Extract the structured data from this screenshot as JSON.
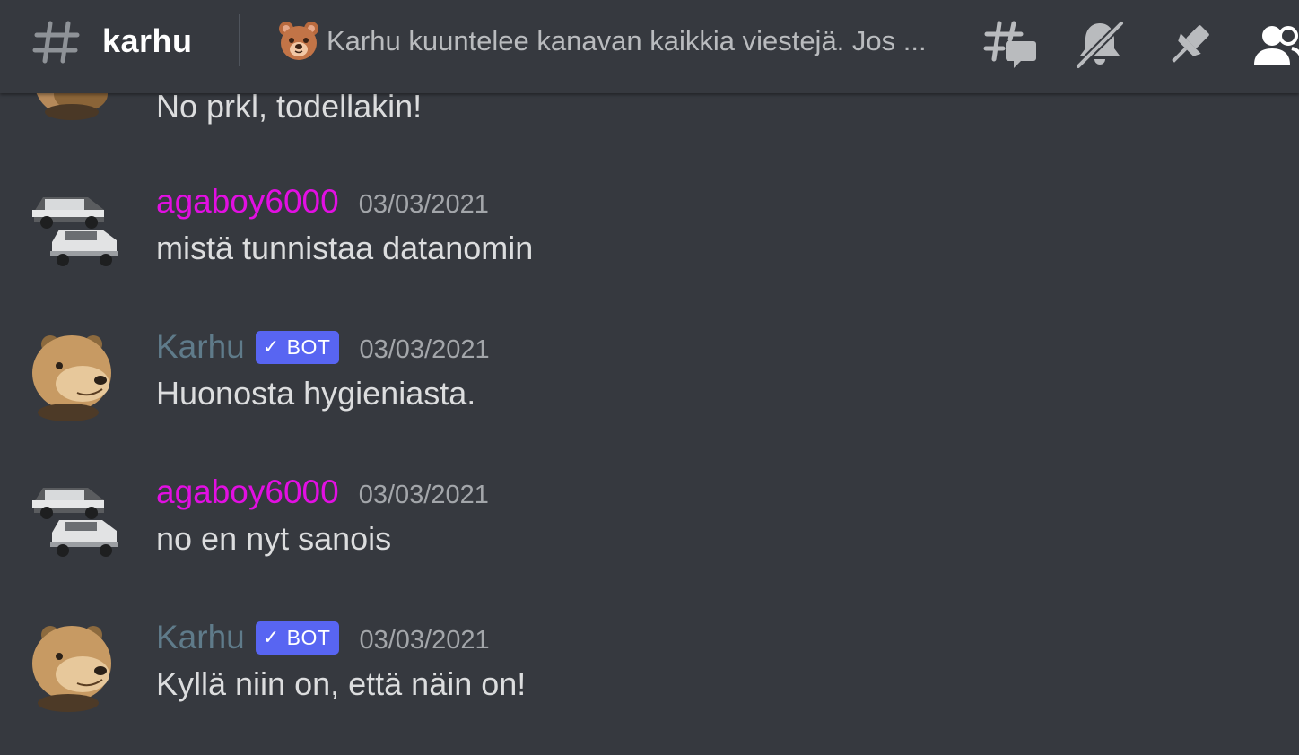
{
  "header": {
    "channel_name": "karhu",
    "topic": "Karhu kuuntelee kanavan kaikkia viestejä. Jos ...",
    "icons": [
      "hashtag-icon",
      "bear-emoji",
      "threads-icon",
      "muted-bell-icon",
      "pin-icon",
      "members-icon"
    ]
  },
  "messages": [
    {
      "partial": true,
      "avatar": "bear",
      "text": "No prkl, todellakin!"
    },
    {
      "author": "agaboy6000",
      "author_color": "#e20fe2",
      "bot": false,
      "timestamp": "03/03/2021",
      "avatar": "cars",
      "text": "mistä tunnistaa datanomin"
    },
    {
      "author": "Karhu",
      "author_color": "#5f7b8a",
      "bot": true,
      "badge": "BOT",
      "timestamp": "03/03/2021",
      "avatar": "bear",
      "text": "Huonosta hygieniasta."
    },
    {
      "author": "agaboy6000",
      "author_color": "#e20fe2",
      "bot": false,
      "timestamp": "03/03/2021",
      "avatar": "cars",
      "text": "no en nyt sanois"
    },
    {
      "author": "Karhu",
      "author_color": "#5f7b8a",
      "bot": true,
      "badge": "BOT",
      "timestamp": "03/03/2021",
      "avatar": "bear",
      "text": "Kyllä niin on, että näin on!"
    }
  ],
  "colors": {
    "background": "#36393f",
    "bot_badge": "#5865f2",
    "text": "#dcddde",
    "muted": "#a3a6aa"
  }
}
